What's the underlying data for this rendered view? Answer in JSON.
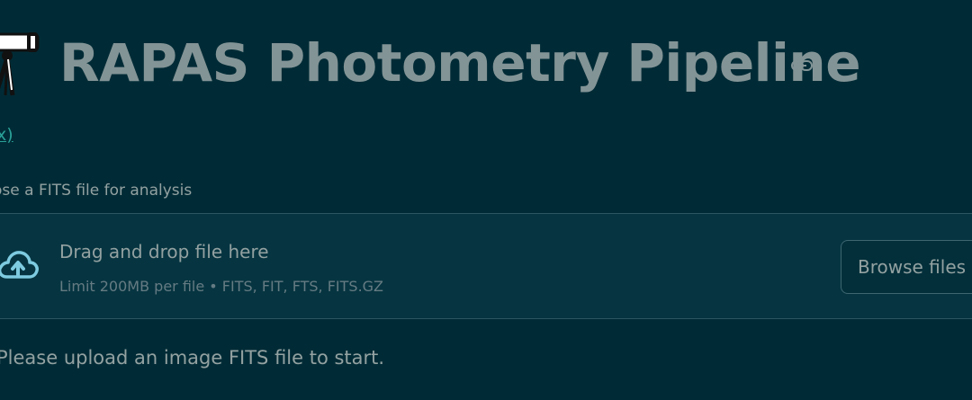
{
  "header": {
    "icon": "telescope-icon",
    "title": "RAPAS Photometry Pipeline",
    "anchor_icon": "link-icon"
  },
  "link": {
    "text": "x)"
  },
  "uploader": {
    "label": "ose a FITS file for analysis",
    "dropzone_icon": "cloud-upload-icon",
    "dropzone_text": "Drag and drop file here",
    "dropzone_limit": "Limit 200MB per file • FITS, FIT, FTS, FITS.GZ",
    "browse_label": "Browse files"
  },
  "info_message": "Please upload an image FITS file to start.",
  "colors": {
    "background": "#002b36",
    "dropzone_background": "#063541",
    "title": "#839496",
    "link": "#2aa198",
    "icon_accent": "#7ecbe0"
  }
}
